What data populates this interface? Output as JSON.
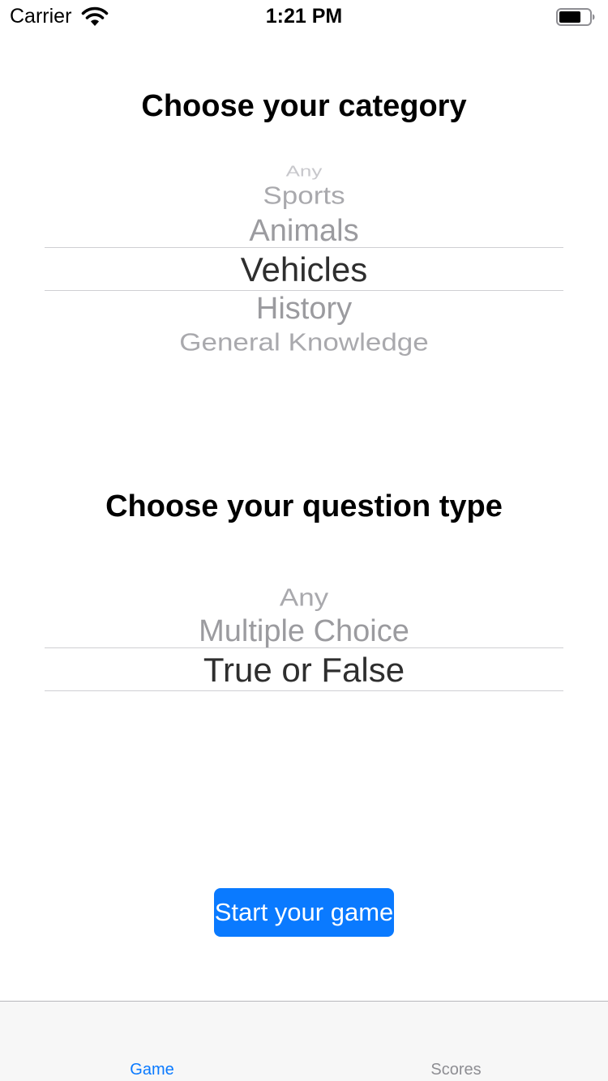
{
  "status_bar": {
    "carrier": "Carrier",
    "time": "1:21 PM",
    "icons": [
      "wifi-icon",
      "battery-icon"
    ]
  },
  "category": {
    "heading": "Choose your category",
    "options": [
      "Any",
      "Sports",
      "Animals",
      "Vehicles",
      "History",
      "General Knowledge"
    ],
    "selected": "Vehicles"
  },
  "question_type": {
    "heading": "Choose your question type",
    "options": [
      "Any",
      "Multiple Choice",
      "True or False"
    ],
    "selected": "True or False"
  },
  "start_button": {
    "label": "Start your game",
    "color": "#0A7AFF"
  },
  "tab_bar": {
    "tabs": [
      {
        "label": "Game",
        "active": true
      },
      {
        "label": "Scores",
        "active": false
      }
    ],
    "active_color": "#0A7AFF",
    "inactive_color": "#8E8E93"
  }
}
